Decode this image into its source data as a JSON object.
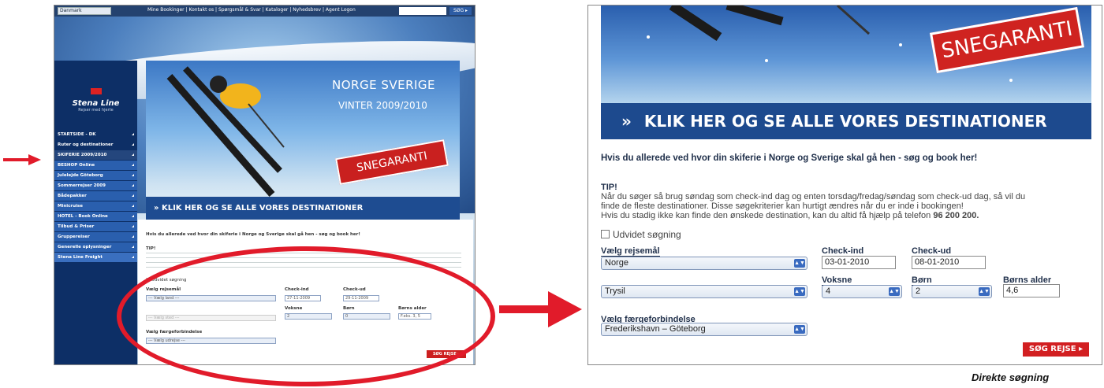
{
  "left": {
    "top_select": "Danmark",
    "top_links": "Mine Bookinger | Kontakt os | Spørgsmål & Svar | Kataloger | Nyhedsbrev | Agent Logon",
    "top_search_btn": "SØG ▸",
    "logo_name": "Stena Line",
    "logo_tag": "Rejser med hjerte",
    "nav": [
      "STARTSIDE - DK",
      "Ruter og destinationer",
      "SKIFERIE 2009/2010",
      "BESHOP Online",
      "Julelejde Göteborg",
      "Sommerrejser 2009",
      "Bådepakker",
      "Minicruise",
      "HOTEL - Book Online",
      "Tilbud & Priser",
      "Gruppereiser",
      "Generelle oplysninger",
      "Stena Line Freight"
    ],
    "banner_line1": "NORGE SVERIGE",
    "banner_line2": "VINTER 2009/2010",
    "snegaranti": "SNEGARANTI",
    "klik": "»  KLIK HER OG SE ALLE VORES DESTINATIONER",
    "intro": "Hvis du allerede ved hvor din skiferie i Norge og Sverige skal gå hen - søg og book her!",
    "tip": "TIP!",
    "udvidet": "Udvidet søgning",
    "vaelg_rejsemaal": "Vælg rejsemål",
    "vaelg_land": "--- Vælg land ---",
    "vaelg_sted": "--- Vælg sted ---",
    "check_ind": "Check-ind",
    "check_ind_val": "27-11-2009",
    "check_ud": "Check-ud",
    "check_ud_val": "29-11-2009",
    "voksne": "Voksne",
    "voksne_val": "2",
    "boern": "Børn",
    "boern_val": "0",
    "boerns_alder": "Børns alder",
    "boerns_alder_val": "F.eks. 3, 5",
    "vaelg_faerge": "Vælg færgeforbindelse",
    "vaelg_udrejse": "--- Vælg udrejse ---",
    "sog_rejse": "SØG REJSE ▸"
  },
  "right": {
    "snegaranti": "SNEGARANTI",
    "klik": "KLIK HER OG SE ALLE VORES DESTINATIONER",
    "intro": "Hvis du allerede ved hvor din skiferie i Norge og Sverige skal gå hen - søg og book her!",
    "tip": "TIP!",
    "tip_line1": "Når du søger så brug søndag som check-ind dag og enten torsdag/fredag/søndag som check-ud dag, så vil du",
    "tip_line2": "finde de fleste destinationer. Disse søgekriterier kan hurtigt ændres når du er inde i bookingen!",
    "tip_line3": "Hvis du stadig ikke kan finde den ønskede destination, kan du altid få hjælp på telefon",
    "phone": "96 200 200.",
    "udvidet": "Udvidet søgning",
    "vaelg_rejsemaal": "Vælg rejsemål",
    "land_val": "Norge",
    "sted_val": "Trysil",
    "check_ind": "Check-ind",
    "check_ind_val": "03-01-2010",
    "check_ud": "Check-ud",
    "check_ud_val": "08-01-2010",
    "voksne": "Voksne",
    "voksne_val": "4",
    "boern": "Børn",
    "boern_val": "2",
    "boerns_alder": "Børns alder",
    "boerns_alder_val": "4,6",
    "vaelg_faerge": "Vælg færgeforbindelse",
    "faerge_val": "Frederikshavn – Göteborg",
    "sog_rejse": "SØG REJSE ▸"
  },
  "caption": "Direkte søgning",
  "colors": {
    "stena_navy": "#0d2f66",
    "accent_red": "#e11b2a",
    "button_red": "#d21f21"
  }
}
